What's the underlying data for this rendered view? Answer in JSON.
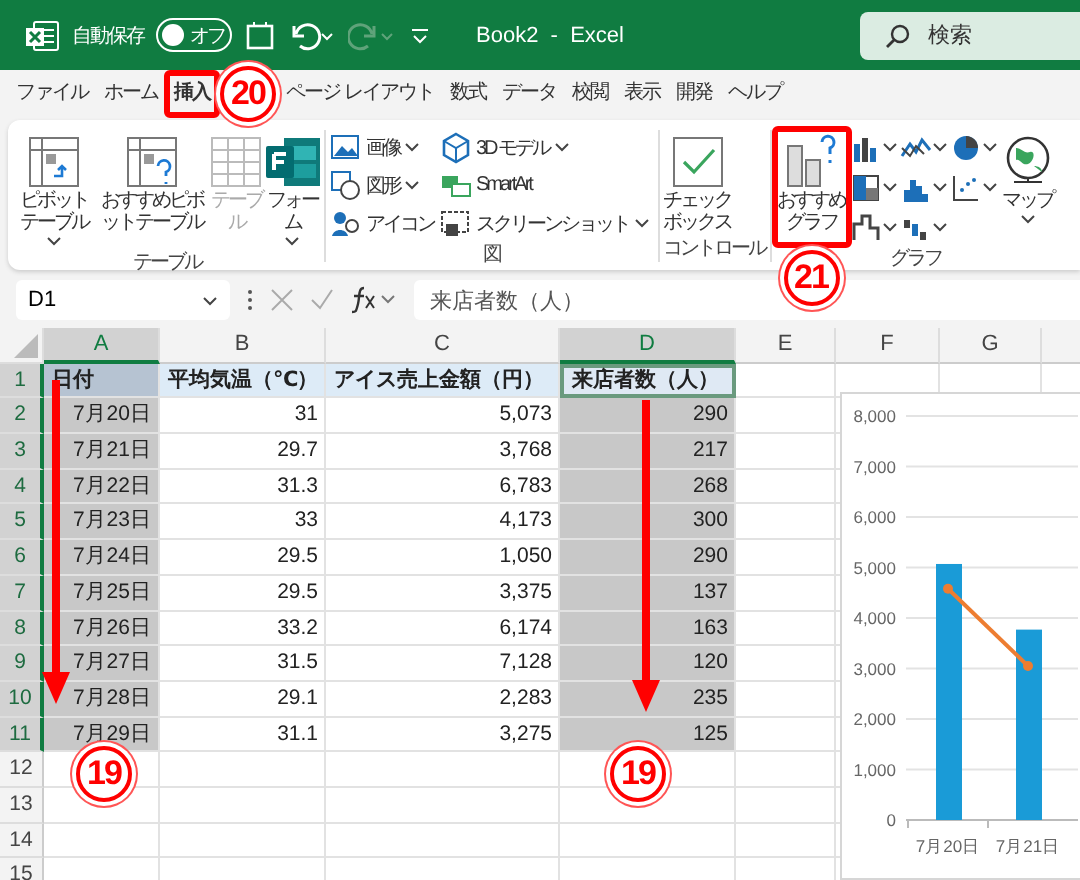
{
  "title_bar": {
    "autosave_label": "自動保存",
    "autosave_toggle": {
      "label": "オフ",
      "on": false
    },
    "redo_disabled": true,
    "title": "Book2  -  Excel",
    "search": {
      "placeholder": "検索"
    }
  },
  "menu_tabs": [
    {
      "label": "ファイル",
      "selected": false
    },
    {
      "label": "ホーム",
      "selected": false
    },
    {
      "label": "挿入",
      "selected": true
    },
    {
      "label": "ページ レイアウト",
      "selected": false
    },
    {
      "label": "数式",
      "selected": false
    },
    {
      "label": "データ",
      "selected": false
    },
    {
      "label": "校閲",
      "selected": false
    },
    {
      "label": "表示",
      "selected": false
    },
    {
      "label": "開発",
      "selected": false
    },
    {
      "label": "ヘルプ",
      "selected": false
    }
  ],
  "ribbon": {
    "groups": [
      {
        "label": "テーブル",
        "items": [
          {
            "kind": "large",
            "label": "ピボットテーブル",
            "dropdown": true,
            "disabled": false
          },
          {
            "kind": "large",
            "label": "おすすめピボットテーブル",
            "dropdown": false,
            "disabled": false
          },
          {
            "kind": "large",
            "label": "テーブル",
            "dropdown": false,
            "disabled": true
          },
          {
            "kind": "large",
            "label": "フォーム",
            "dropdown": true,
            "disabled": false
          }
        ]
      },
      {
        "label": "図",
        "items": [
          {
            "kind": "small",
            "label": "画像",
            "dropdown": true,
            "disabled": false
          },
          {
            "kind": "small",
            "label": "図形",
            "dropdown": true,
            "disabled": false
          },
          {
            "kind": "small",
            "label": "アイコン",
            "dropdown": false,
            "disabled": false
          },
          {
            "kind": "small",
            "label": "3D モデル",
            "dropdown": true,
            "disabled": false
          },
          {
            "kind": "small",
            "label": "SmartArt",
            "dropdown": false,
            "disabled": false
          },
          {
            "kind": "small",
            "label": "スクリーンショット",
            "dropdown": true,
            "disabled": false
          }
        ]
      },
      {
        "label": "コントロール",
        "items": [
          {
            "kind": "large",
            "label": "チェックボックス",
            "dropdown": false,
            "disabled": false
          }
        ]
      },
      {
        "label": "グラフ",
        "items": [
          {
            "kind": "large",
            "label": "おすすめグラフ",
            "dropdown": false,
            "disabled": false
          },
          {
            "kind": "icon",
            "dropdown": true
          },
          {
            "kind": "icon",
            "dropdown": true
          },
          {
            "kind": "icon",
            "dropdown": true
          },
          {
            "kind": "icon",
            "dropdown": true
          },
          {
            "kind": "icon",
            "dropdown": true
          },
          {
            "kind": "icon",
            "dropdown": true
          },
          {
            "kind": "icon",
            "dropdown": true
          },
          {
            "kind": "icon",
            "dropdown": true
          },
          {
            "kind": "large",
            "label": "マップ",
            "dropdown": true,
            "disabled": false
          }
        ]
      }
    ]
  },
  "formula_bar": {
    "name_box": "D1",
    "formula": "来店者数（人）"
  },
  "sheet": {
    "columns": [
      {
        "label": "A",
        "selected": true
      },
      {
        "label": "B",
        "selected": false
      },
      {
        "label": "C",
        "selected": false
      },
      {
        "label": "D",
        "selected": true
      },
      {
        "label": "E",
        "selected": false
      },
      {
        "label": "F",
        "selected": false
      },
      {
        "label": "G",
        "selected": false
      }
    ],
    "rows": [
      {
        "number": "1",
        "selected": true,
        "cells": [
          {
            "text": "日付",
            "kind": "header",
            "selected": true,
            "active": false
          },
          {
            "text": "平均気温（℃）",
            "kind": "header",
            "selected": false,
            "active": false
          },
          {
            "text": "アイス売上金額（円）",
            "kind": "header",
            "selected": false,
            "active": false
          },
          {
            "text": "来店者数（人）",
            "kind": "header",
            "selected": true,
            "active": true
          }
        ]
      },
      {
        "number": "2",
        "selected": true,
        "cells": [
          {
            "text": "7月20日",
            "kind": "number",
            "selected": true,
            "active": false
          },
          {
            "text": "31",
            "kind": "number",
            "selected": false,
            "active": false
          },
          {
            "text": "5,073",
            "kind": "number",
            "selected": false,
            "active": false
          },
          {
            "text": "290",
            "kind": "number",
            "selected": true,
            "active": false
          }
        ]
      },
      {
        "number": "3",
        "selected": true,
        "cells": [
          {
            "text": "7月21日",
            "kind": "number",
            "selected": true,
            "active": false
          },
          {
            "text": "29.7",
            "kind": "number",
            "selected": false,
            "active": false
          },
          {
            "text": "3,768",
            "kind": "number",
            "selected": false,
            "active": false
          },
          {
            "text": "217",
            "kind": "number",
            "selected": true,
            "active": false
          }
        ]
      },
      {
        "number": "4",
        "selected": true,
        "cells": [
          {
            "text": "7月22日",
            "kind": "number",
            "selected": true,
            "active": false
          },
          {
            "text": "31.3",
            "kind": "number",
            "selected": false,
            "active": false
          },
          {
            "text": "6,783",
            "kind": "number",
            "selected": false,
            "active": false
          },
          {
            "text": "268",
            "kind": "number",
            "selected": true,
            "active": false
          }
        ]
      },
      {
        "number": "5",
        "selected": true,
        "cells": [
          {
            "text": "7月23日",
            "kind": "number",
            "selected": true,
            "active": false
          },
          {
            "text": "33",
            "kind": "number",
            "selected": false,
            "active": false
          },
          {
            "text": "4,173",
            "kind": "number",
            "selected": false,
            "active": false
          },
          {
            "text": "300",
            "kind": "number",
            "selected": true,
            "active": false
          }
        ]
      },
      {
        "number": "6",
        "selected": true,
        "cells": [
          {
            "text": "7月24日",
            "kind": "number",
            "selected": true,
            "active": false
          },
          {
            "text": "29.5",
            "kind": "number",
            "selected": false,
            "active": false
          },
          {
            "text": "1,050",
            "kind": "number",
            "selected": false,
            "active": false
          },
          {
            "text": "290",
            "kind": "number",
            "selected": true,
            "active": false
          }
        ]
      },
      {
        "number": "7",
        "selected": true,
        "cells": [
          {
            "text": "7月25日",
            "kind": "number",
            "selected": true,
            "active": false
          },
          {
            "text": "29.5",
            "kind": "number",
            "selected": false,
            "active": false
          },
          {
            "text": "3,375",
            "kind": "number",
            "selected": false,
            "active": false
          },
          {
            "text": "137",
            "kind": "number",
            "selected": true,
            "active": false
          }
        ]
      },
      {
        "number": "8",
        "selected": true,
        "cells": [
          {
            "text": "7月26日",
            "kind": "number",
            "selected": true,
            "active": false
          },
          {
            "text": "33.2",
            "kind": "number",
            "selected": false,
            "active": false
          },
          {
            "text": "6,174",
            "kind": "number",
            "selected": false,
            "active": false
          },
          {
            "text": "163",
            "kind": "number",
            "selected": true,
            "active": false
          }
        ]
      },
      {
        "number": "9",
        "selected": true,
        "cells": [
          {
            "text": "7月27日",
            "kind": "number",
            "selected": true,
            "active": false
          },
          {
            "text": "31.5",
            "kind": "number",
            "selected": false,
            "active": false
          },
          {
            "text": "7,128",
            "kind": "number",
            "selected": false,
            "active": false
          },
          {
            "text": "120",
            "kind": "number",
            "selected": true,
            "active": false
          }
        ]
      },
      {
        "number": "10",
        "selected": true,
        "cells": [
          {
            "text": "7月28日",
            "kind": "number",
            "selected": true,
            "active": false
          },
          {
            "text": "29.1",
            "kind": "number",
            "selected": false,
            "active": false
          },
          {
            "text": "2,283",
            "kind": "number",
            "selected": false,
            "active": false
          },
          {
            "text": "235",
            "kind": "number",
            "selected": true,
            "active": false
          }
        ]
      },
      {
        "number": "11",
        "selected": true,
        "cells": [
          {
            "text": "7月29日",
            "kind": "number",
            "selected": true,
            "active": false
          },
          {
            "text": "31.1",
            "kind": "number",
            "selected": false,
            "active": false
          },
          {
            "text": "3,275",
            "kind": "number",
            "selected": false,
            "active": false
          },
          {
            "text": "125",
            "kind": "number",
            "selected": true,
            "active": false
          }
        ]
      },
      {
        "number": "12",
        "selected": false
      },
      {
        "number": "13",
        "selected": false
      },
      {
        "number": "14",
        "selected": false
      },
      {
        "number": "15",
        "selected": false
      }
    ]
  },
  "chart": {
    "chart_data": {
      "type": "bar",
      "grid": true,
      "categories": [
        "7月20日",
        "7月21日"
      ],
      "ylim": [
        0,
        8000
      ],
      "yticks": [
        {
          "value": 0,
          "label": "0"
        },
        {
          "value": 1000,
          "label": "1,000"
        },
        {
          "value": 2000,
          "label": "2,000"
        },
        {
          "value": 3000,
          "label": "3,000"
        },
        {
          "value": 4000,
          "label": "4,000"
        },
        {
          "value": 5000,
          "label": "5,000"
        },
        {
          "value": 6000,
          "label": "6,000"
        },
        {
          "value": 7000,
          "label": "7,000"
        },
        {
          "value": 8000,
          "label": "8,000"
        }
      ],
      "series": [
        {
          "color": "#1a9bd7",
          "values": [
            5070,
            3770
          ]
        },
        {
          "type": "line",
          "marker": true,
          "color": "#ed7d31",
          "values": [
            4580,
            3050
          ]
        }
      ]
    }
  },
  "callouts": [
    {
      "label": "20"
    },
    {
      "label": "21"
    },
    {
      "label": "19"
    },
    {
      "label": "19"
    }
  ]
}
